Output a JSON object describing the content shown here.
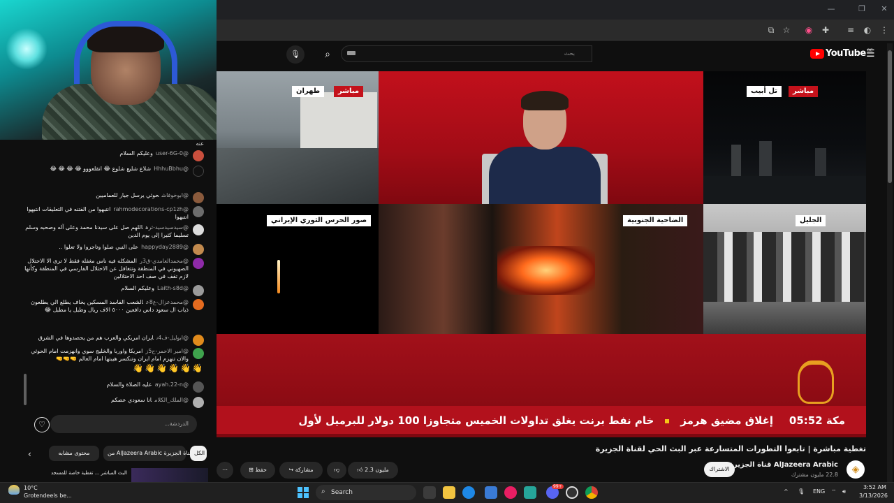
{
  "search": {
    "placeholder": "بحث",
    "query": ""
  },
  "youtube": {
    "logo_text": "YouTube",
    "region": "BE"
  },
  "live_labels": {
    "tehran_live": "مباشر",
    "tehran_city": "طهران",
    "telaviv_live": "مباشر",
    "telaviv_city": "تل أبيب",
    "irgc": "صور الحرس الثوري الإيراني",
    "dahiyeh": "الضاحية الجنوبية",
    "galilee": "الجليل"
  },
  "ticker": {
    "headline_1": "إغلاق مضيق هرمز",
    "headline_2": "خام نفط برنت يغلق تداولات الخميس متجاوزا 100 دولار للبرميل لأول",
    "time": "05:52",
    "location": "مكة"
  },
  "video": {
    "title": "تغطية مباشرة | تابعوا التطورات المتسارعة عبر البث الحي لقناة الجزيرة",
    "likes": "2.3 مليون",
    "share_label": "مشاركة",
    "save_label": "حفظ",
    "more_label": "⋯"
  },
  "channel": {
    "name": "AlJazeera Arabic قناة الجزيرة",
    "subscribers": "22.8 مليون مشترك",
    "subscribe_label": "الاشتراك"
  },
  "chat": {
    "messages": [
      {
        "author": "@user-6G-0",
        "text": "وعليكم السلام",
        "avatar_color": "#c94f3d"
      },
      {
        "author": "@HhhuBbhu",
        "text": "شلاع شليع شلوع 😂 انقلعووو 😂 😂 😂 😂",
        "avatar_color": "#111111"
      },
      {
        "author": "@ابوخوفاش",
        "text": "حوثي يرسل جيار للعماميين",
        "avatar_color": "#8a5a3c"
      },
      {
        "author": "@rahmodecorations-cp1zh",
        "text": "انتبهوا من الفتنه في التعليقات انتبهوا انتبهوا",
        "avatar_color": "#6d6d6d"
      },
      {
        "author": "@سيدسيدسيد-ثره",
        "text": "اللهم صل على سيدنا محمد وعلى آله وصحبه وسلم تسليما كثيرا إلى يوم الدين",
        "avatar_color": "#dcdcdc"
      },
      {
        "author": "@happyday2889",
        "text": "على النبي صلوا وتاجروا ولا تعلوا ..",
        "avatar_color": "#c28a4e"
      },
      {
        "author": "@محمدالعامدي-ق3ر",
        "text": "المشكله فيه ناس مغفله فقط لا ترى الا الاحتلال الصهيوني في المنطقة وتتغافل عن الاحتلال الفارسي في المنطقة وكأنها لازم تقف في صف احد الاحتلالين",
        "avatar_color": "#8e2aa8"
      },
      {
        "author": "@Laith-s8d",
        "text": "وعليكم السلام",
        "avatar_color": "#9a9a9a"
      },
      {
        "author": "@محمدعزال-ع8ع",
        "text": "الشعب الفاسد المسكين يخاف يطلع الي يطلعون ذياب ال سعود داس دافعين ٥٠٠٠ الاف ريال وطبل يا مطبل 😂",
        "avatar_color": "#e56b1f"
      },
      {
        "author": "@ابوليل-ف4ن",
        "text": "ايران امريكي والعرب هم من يحصدوها في الشرق",
        "avatar_color": "#e08a1c"
      },
      {
        "author": "@امير الاحمر-ح5ز",
        "text": "امريكا واوربا والخليج سوي وانهزمت امام الحوثي والان تنهزم امام ايران وتنكسر هيبتها امام العالم 🤜🤜🤜",
        "avatar_color": "#3fa34d"
      },
      {
        "author": "",
        "text": "👋👋👋👋👋👋",
        "avatar_color": ""
      },
      {
        "author": "@ayah.22-n",
        "text": "عليه الصلاة والسلام",
        "avatar_color": "#555555"
      },
      {
        "author": "@الملك_الكلام",
        "text": "انا سعودي عصكم",
        "avatar_color": "#b0b0b0"
      }
    ],
    "input_placeholder": "الدردشة...",
    "user_line": "عنه",
    "chips": [
      "الكل",
      "من AlJazeera Arabic قناة الجزيرة",
      "محتوى مشابه"
    ],
    "next_video": "البث المباشر ... تغطية خاصة للمسجد"
  },
  "taskbar": {
    "weather_temp": "10°C",
    "weather_desc": "Grotendeels be...",
    "search_label": "Search",
    "lang": "ENG",
    "time": "3:52 AM",
    "date": "3/13/2026",
    "badge": "99+"
  },
  "colors": {
    "aj_red": "#b2111c",
    "aj_label_red": "#c4121b",
    "yt_red": "#ff0000",
    "ticker_dot": "#f5c518"
  }
}
